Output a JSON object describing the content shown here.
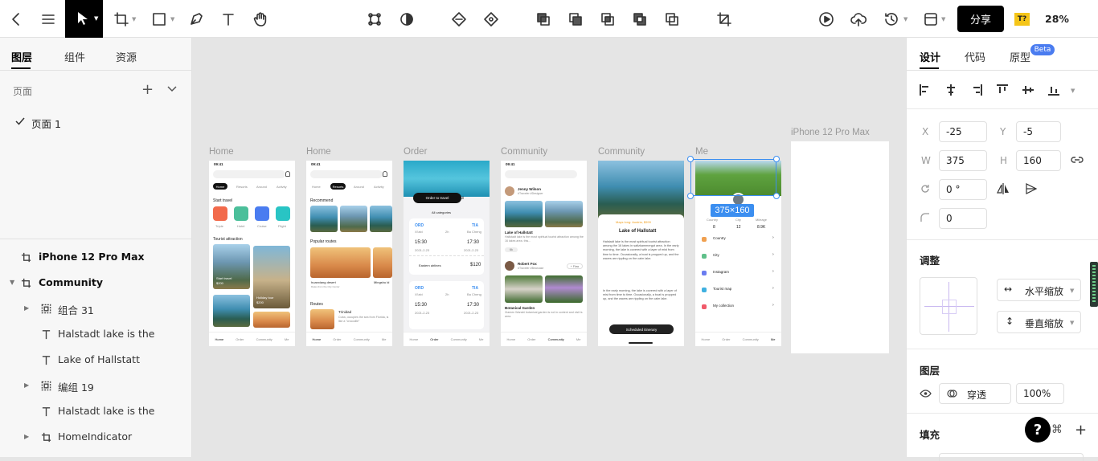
{
  "toolbar": {
    "share_label": "分享",
    "zoom": "28%",
    "badge": "T?"
  },
  "left": {
    "tabs": [
      "图层",
      "组件",
      "资源"
    ],
    "pages_title": "页面",
    "pages": [
      "页面 1"
    ],
    "layers": [
      {
        "label": "iPhone 12 Pro Max",
        "kind": "frame",
        "bold": true
      },
      {
        "label": "Community",
        "kind": "frame",
        "bold": true
      },
      {
        "label": "组合 31",
        "kind": "group"
      },
      {
        "label": "Halstadt lake is the",
        "kind": "text"
      },
      {
        "label": "Lake of Hallstatt",
        "kind": "text"
      },
      {
        "label": "编组 19",
        "kind": "group"
      },
      {
        "label": "Halstadt lake is the",
        "kind": "text"
      },
      {
        "label": "HomeIndicator",
        "kind": "frame"
      }
    ]
  },
  "canvas": {
    "frame_labels": [
      "Home",
      "Home",
      "Order",
      "Community",
      "Community",
      "Me",
      "iPhone 12 Pro Max"
    ],
    "selection_size": "375×160",
    "phones": {
      "time": "09:41",
      "home1": {
        "tabs": [
          "Home",
          "Resorts",
          "Around",
          "Activity"
        ],
        "start_travel": "Start travel",
        "categories": [
          "Triple",
          "Hotel",
          "Cruise",
          "Flight"
        ],
        "tourist": "Tourist attraction",
        "card1": "Start travel",
        "card1_sub": "$200",
        "card2": "Holiday tour",
        "card2_sub": "$200",
        "nav": [
          "Home",
          "Order",
          "Community",
          "Me"
        ]
      },
      "home2": {
        "tabs": [
          "Home",
          "Resorts",
          "Around",
          "Activity"
        ],
        "recommend": "Recommend",
        "popular": "Popular routes",
        "route1": "huanxiang desert",
        "route1_sub": "Dates from the City Center",
        "route2": "Mingshu ld",
        "routes": "Routes",
        "place": "Trinidad",
        "place_desc": "Cuba, occupies the sea from Florida, is like a \"crocodile\"",
        "nav": [
          "Home",
          "Order",
          "Community",
          "Me"
        ]
      },
      "order": {
        "tab_active": "Order to travel",
        "tab_all": "All",
        "filter": "All categories",
        "from": "ORD",
        "to": "TIA",
        "from_city": "Xi'abi",
        "duration": "2h",
        "to_city": "Ba Cheng",
        "dep": "15:30",
        "arr": "17:30",
        "date1": "2021-2-23",
        "date2": "2021-2-23",
        "airline": "Eastern airlines",
        "price": "$120",
        "nav": [
          "Home",
          "Order",
          "Community",
          "Me"
        ]
      },
      "community1": {
        "user": "Jenny Wilson",
        "user_sub": "#Traveler #Designer",
        "post_title": "Lake of Hallstatt",
        "post_desc": "Hallstadt lake is the most spiritual tourist attraction among the 16 lakes area. this...",
        "like": "6k",
        "user2": "Robert Fox",
        "user2_sub": "#Traveler #Bearcase",
        "follow": "+ Flow",
        "post2_title": "Botanical Garden",
        "post2_desc": "Xiamen Wanshi botanical garden is not in content and visit is area.",
        "nav": [
          "Home",
          "Order",
          "Community",
          "Me"
        ]
      },
      "community2": {
        "location": "Mays long: Austria, $999",
        "title": "Lake of Hallstatt",
        "para1": "Halstadt lake is the most spiritual tourist attraction among the 16 lakes in saltzkammergut area. In the early morning, the lake is covered with a layer of mist from time to time. Occasionally, a boat is propped up, and the waves are rippling on the calm lake.",
        "para2": "In the early morning, the lake is covered with a layer of mist from time to time. Occasionally, a boat is propped up, and the waves are rippling on the calm lake.",
        "button": "Scheduled itinerary"
      },
      "me": {
        "stats_labels": [
          "Country",
          "City",
          "Mileage"
        ],
        "stats_values": [
          "8",
          "12",
          "8.9K"
        ],
        "menu": [
          "Country",
          "City",
          "Instagram",
          "Tourist map",
          "My collection"
        ],
        "nav": [
          "Home",
          "Order",
          "Community",
          "Me"
        ]
      }
    }
  },
  "right": {
    "tabs": [
      "设计",
      "代码",
      "原型"
    ],
    "beta": "Beta",
    "x_label": "X",
    "x": "-25",
    "y_label": "Y",
    "y": "-5",
    "w_label": "W",
    "w": "375",
    "h_label": "H",
    "h": "160",
    "rotation": "0 °",
    "radius": "0",
    "adjust_title": "调整",
    "h_scale": "水平缩放",
    "v_scale": "垂直缩放",
    "layer_title": "图层",
    "blend": "穿透",
    "opacity": "100%",
    "fill_title": "填充",
    "help": "?"
  },
  "colors": {
    "accent": "#3b8ef0",
    "black": "#000000",
    "badge_bg": "#f5c518"
  }
}
